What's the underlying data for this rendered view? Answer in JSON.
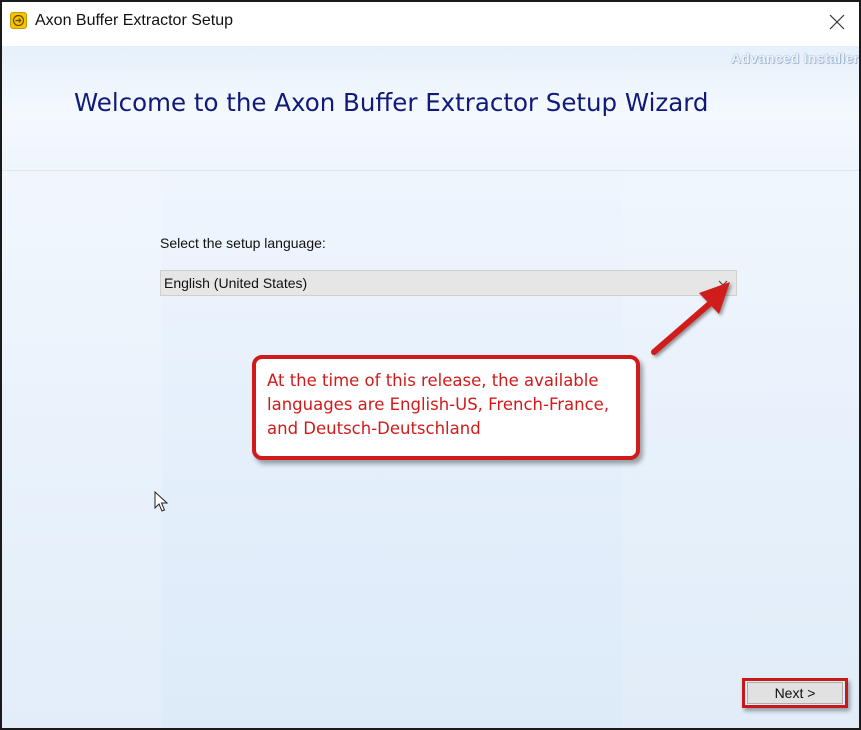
{
  "window": {
    "title": "Axon Buffer Extractor Setup",
    "close_symbol": "close-icon",
    "app_icon": "setup-app-icon"
  },
  "header": {
    "brand": "Advanced Installer",
    "heading": "Welcome to the Axon Buffer Extractor Setup Wizard"
  },
  "language": {
    "label": "Select the setup language:",
    "selected": "English (United States)"
  },
  "callout": {
    "text": "At the time of this release, the available languages are English-US, French-France, and Deutsch-Deutschland"
  },
  "footer": {
    "next_label": "Next >"
  },
  "colors": {
    "accent_red": "#d11a1a",
    "heading_blue": "#111a78",
    "background": "#e6f0fb"
  }
}
